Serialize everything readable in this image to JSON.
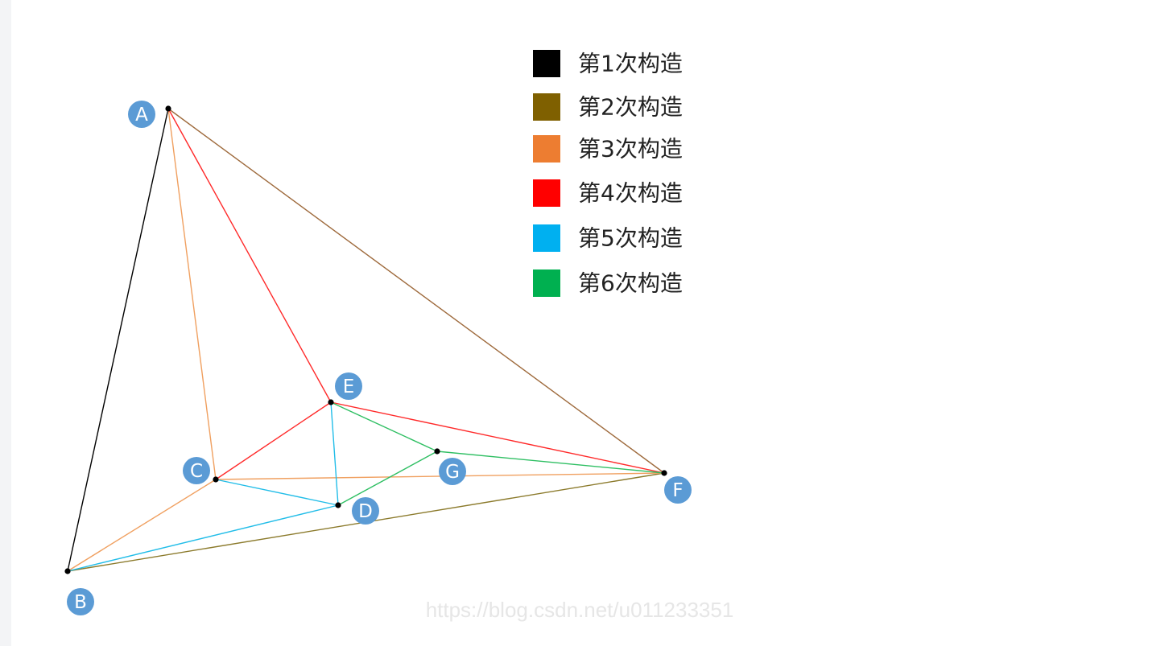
{
  "legend": [
    {
      "label": "第1次构造",
      "color": "#000000"
    },
    {
      "label": "第2次构造",
      "color": "#7f6000"
    },
    {
      "label": "第3次构造",
      "color": "#ed7d31"
    },
    {
      "label": "第4次构造",
      "color": "#ff0000"
    },
    {
      "label": "第5次构造",
      "color": "#00b0f0"
    },
    {
      "label": "第6次构造",
      "color": "#00b050"
    }
  ],
  "node_badge_color": "#5b9bd5",
  "nodes": [
    {
      "id": "A",
      "label": "A"
    },
    {
      "id": "B",
      "label": "B"
    },
    {
      "id": "C",
      "label": "C"
    },
    {
      "id": "D",
      "label": "D"
    },
    {
      "id": "E",
      "label": "E"
    },
    {
      "id": "F",
      "label": "F"
    },
    {
      "id": "G",
      "label": "G"
    }
  ],
  "edges": [
    {
      "from": "A",
      "to": "B",
      "stage": 1
    },
    {
      "from": "A",
      "to": "F",
      "stage": 2
    },
    {
      "from": "B",
      "to": "F",
      "stage": 2
    },
    {
      "from": "A",
      "to": "C",
      "stage": 3
    },
    {
      "from": "B",
      "to": "C",
      "stage": 3
    },
    {
      "from": "C",
      "to": "F",
      "stage": 3
    },
    {
      "from": "A",
      "to": "E",
      "stage": 4
    },
    {
      "from": "C",
      "to": "E",
      "stage": 4
    },
    {
      "from": "E",
      "to": "F",
      "stage": 4
    },
    {
      "from": "E",
      "to": "D",
      "stage": 5
    },
    {
      "from": "C",
      "to": "D",
      "stage": 5
    },
    {
      "from": "B",
      "to": "D",
      "stage": 5
    },
    {
      "from": "E",
      "to": "G",
      "stage": 6
    },
    {
      "from": "D",
      "to": "G",
      "stage": 6
    },
    {
      "from": "G",
      "to": "F",
      "stage": 6
    }
  ],
  "watermark": "https://blog.csdn.net/u011233351"
}
